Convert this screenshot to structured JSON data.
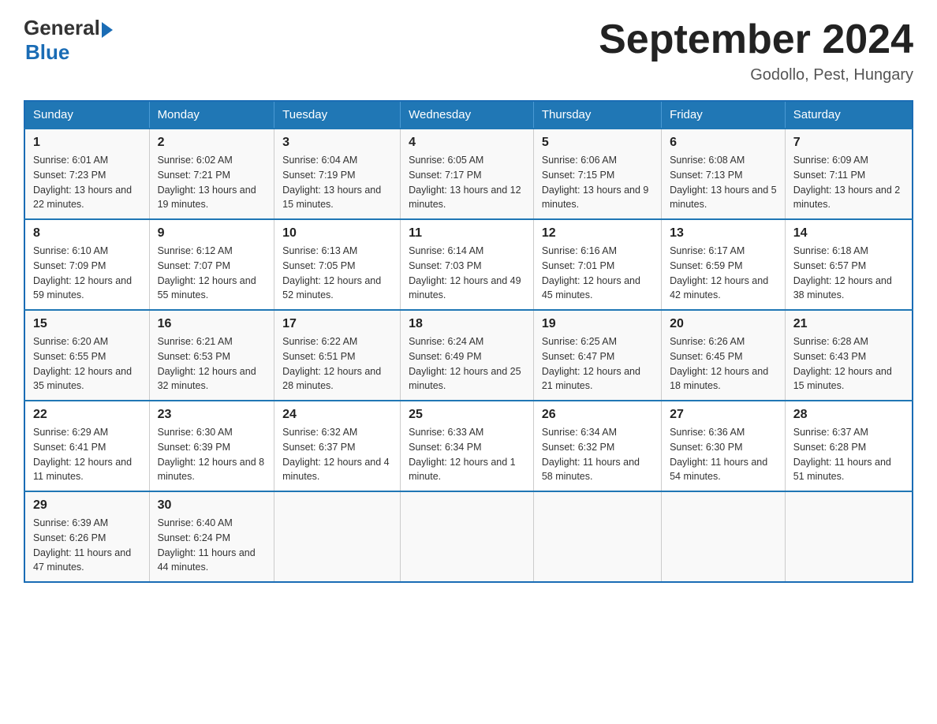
{
  "header": {
    "logo_general": "General",
    "logo_blue": "Blue",
    "month_title": "September 2024",
    "location": "Godollo, Pest, Hungary"
  },
  "days_of_week": [
    "Sunday",
    "Monday",
    "Tuesday",
    "Wednesday",
    "Thursday",
    "Friday",
    "Saturday"
  ],
  "weeks": [
    [
      {
        "day": "1",
        "sunrise": "Sunrise: 6:01 AM",
        "sunset": "Sunset: 7:23 PM",
        "daylight": "Daylight: 13 hours and 22 minutes."
      },
      {
        "day": "2",
        "sunrise": "Sunrise: 6:02 AM",
        "sunset": "Sunset: 7:21 PM",
        "daylight": "Daylight: 13 hours and 19 minutes."
      },
      {
        "day": "3",
        "sunrise": "Sunrise: 6:04 AM",
        "sunset": "Sunset: 7:19 PM",
        "daylight": "Daylight: 13 hours and 15 minutes."
      },
      {
        "day": "4",
        "sunrise": "Sunrise: 6:05 AM",
        "sunset": "Sunset: 7:17 PM",
        "daylight": "Daylight: 13 hours and 12 minutes."
      },
      {
        "day": "5",
        "sunrise": "Sunrise: 6:06 AM",
        "sunset": "Sunset: 7:15 PM",
        "daylight": "Daylight: 13 hours and 9 minutes."
      },
      {
        "day": "6",
        "sunrise": "Sunrise: 6:08 AM",
        "sunset": "Sunset: 7:13 PM",
        "daylight": "Daylight: 13 hours and 5 minutes."
      },
      {
        "day": "7",
        "sunrise": "Sunrise: 6:09 AM",
        "sunset": "Sunset: 7:11 PM",
        "daylight": "Daylight: 13 hours and 2 minutes."
      }
    ],
    [
      {
        "day": "8",
        "sunrise": "Sunrise: 6:10 AM",
        "sunset": "Sunset: 7:09 PM",
        "daylight": "Daylight: 12 hours and 59 minutes."
      },
      {
        "day": "9",
        "sunrise": "Sunrise: 6:12 AM",
        "sunset": "Sunset: 7:07 PM",
        "daylight": "Daylight: 12 hours and 55 minutes."
      },
      {
        "day": "10",
        "sunrise": "Sunrise: 6:13 AM",
        "sunset": "Sunset: 7:05 PM",
        "daylight": "Daylight: 12 hours and 52 minutes."
      },
      {
        "day": "11",
        "sunrise": "Sunrise: 6:14 AM",
        "sunset": "Sunset: 7:03 PM",
        "daylight": "Daylight: 12 hours and 49 minutes."
      },
      {
        "day": "12",
        "sunrise": "Sunrise: 6:16 AM",
        "sunset": "Sunset: 7:01 PM",
        "daylight": "Daylight: 12 hours and 45 minutes."
      },
      {
        "day": "13",
        "sunrise": "Sunrise: 6:17 AM",
        "sunset": "Sunset: 6:59 PM",
        "daylight": "Daylight: 12 hours and 42 minutes."
      },
      {
        "day": "14",
        "sunrise": "Sunrise: 6:18 AM",
        "sunset": "Sunset: 6:57 PM",
        "daylight": "Daylight: 12 hours and 38 minutes."
      }
    ],
    [
      {
        "day": "15",
        "sunrise": "Sunrise: 6:20 AM",
        "sunset": "Sunset: 6:55 PM",
        "daylight": "Daylight: 12 hours and 35 minutes."
      },
      {
        "day": "16",
        "sunrise": "Sunrise: 6:21 AM",
        "sunset": "Sunset: 6:53 PM",
        "daylight": "Daylight: 12 hours and 32 minutes."
      },
      {
        "day": "17",
        "sunrise": "Sunrise: 6:22 AM",
        "sunset": "Sunset: 6:51 PM",
        "daylight": "Daylight: 12 hours and 28 minutes."
      },
      {
        "day": "18",
        "sunrise": "Sunrise: 6:24 AM",
        "sunset": "Sunset: 6:49 PM",
        "daylight": "Daylight: 12 hours and 25 minutes."
      },
      {
        "day": "19",
        "sunrise": "Sunrise: 6:25 AM",
        "sunset": "Sunset: 6:47 PM",
        "daylight": "Daylight: 12 hours and 21 minutes."
      },
      {
        "day": "20",
        "sunrise": "Sunrise: 6:26 AM",
        "sunset": "Sunset: 6:45 PM",
        "daylight": "Daylight: 12 hours and 18 minutes."
      },
      {
        "day": "21",
        "sunrise": "Sunrise: 6:28 AM",
        "sunset": "Sunset: 6:43 PM",
        "daylight": "Daylight: 12 hours and 15 minutes."
      }
    ],
    [
      {
        "day": "22",
        "sunrise": "Sunrise: 6:29 AM",
        "sunset": "Sunset: 6:41 PM",
        "daylight": "Daylight: 12 hours and 11 minutes."
      },
      {
        "day": "23",
        "sunrise": "Sunrise: 6:30 AM",
        "sunset": "Sunset: 6:39 PM",
        "daylight": "Daylight: 12 hours and 8 minutes."
      },
      {
        "day": "24",
        "sunrise": "Sunrise: 6:32 AM",
        "sunset": "Sunset: 6:37 PM",
        "daylight": "Daylight: 12 hours and 4 minutes."
      },
      {
        "day": "25",
        "sunrise": "Sunrise: 6:33 AM",
        "sunset": "Sunset: 6:34 PM",
        "daylight": "Daylight: 12 hours and 1 minute."
      },
      {
        "day": "26",
        "sunrise": "Sunrise: 6:34 AM",
        "sunset": "Sunset: 6:32 PM",
        "daylight": "Daylight: 11 hours and 58 minutes."
      },
      {
        "day": "27",
        "sunrise": "Sunrise: 6:36 AM",
        "sunset": "Sunset: 6:30 PM",
        "daylight": "Daylight: 11 hours and 54 minutes."
      },
      {
        "day": "28",
        "sunrise": "Sunrise: 6:37 AM",
        "sunset": "Sunset: 6:28 PM",
        "daylight": "Daylight: 11 hours and 51 minutes."
      }
    ],
    [
      {
        "day": "29",
        "sunrise": "Sunrise: 6:39 AM",
        "sunset": "Sunset: 6:26 PM",
        "daylight": "Daylight: 11 hours and 47 minutes."
      },
      {
        "day": "30",
        "sunrise": "Sunrise: 6:40 AM",
        "sunset": "Sunset: 6:24 PM",
        "daylight": "Daylight: 11 hours and 44 minutes."
      },
      null,
      null,
      null,
      null,
      null
    ]
  ]
}
